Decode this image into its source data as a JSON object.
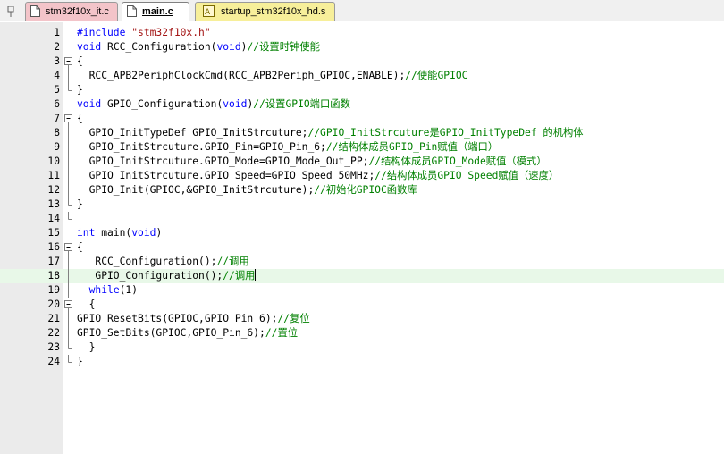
{
  "tabs": [
    {
      "label": "stm32f10x_it.c",
      "color": "#f3c4c9"
    },
    {
      "label": "main.c",
      "color": "#ffffff",
      "active": true
    },
    {
      "label": "startup_stm32f10x_hd.s",
      "color": "#f7ef9a"
    }
  ],
  "editor": {
    "colors": {
      "keyword": "#0000ff",
      "string": "#a31515",
      "comment": "#008000",
      "current_line": "#e8f8e8"
    },
    "current_line": 18,
    "lines": [
      {
        "n": "1",
        "fold": "",
        "segs": [
          {
            "t": "pp",
            "v": "#include "
          },
          {
            "t": "str",
            "v": "\"stm32f10x.h\""
          }
        ]
      },
      {
        "n": "2",
        "fold": "",
        "segs": [
          {
            "t": "kw",
            "v": "void"
          },
          {
            "t": "",
            "v": " RCC_Configuration("
          },
          {
            "t": "kw",
            "v": "void"
          },
          {
            "t": "",
            "v": ")"
          },
          {
            "t": "cm",
            "v": "//设置时钟使能"
          }
        ]
      },
      {
        "n": "3",
        "fold": "start",
        "segs": [
          {
            "t": "",
            "v": "{"
          }
        ]
      },
      {
        "n": "4",
        "fold": "mid",
        "segs": [
          {
            "t": "",
            "v": "  RCC_APB2PeriphClockCmd(RCC_APB2Periph_GPIOC,ENABLE);"
          },
          {
            "t": "cm",
            "v": "//使能GPIOC"
          }
        ]
      },
      {
        "n": "5",
        "fold": "end",
        "segs": [
          {
            "t": "",
            "v": "}"
          }
        ]
      },
      {
        "n": "6",
        "fold": "",
        "segs": [
          {
            "t": "kw",
            "v": "void"
          },
          {
            "t": "",
            "v": " GPIO_Configuration("
          },
          {
            "t": "kw",
            "v": "void"
          },
          {
            "t": "",
            "v": ")"
          },
          {
            "t": "cm",
            "v": "//设置GPIO端口函数"
          }
        ]
      },
      {
        "n": "7",
        "fold": "start",
        "segs": [
          {
            "t": "",
            "v": "{"
          }
        ]
      },
      {
        "n": "8",
        "fold": "mid",
        "segs": [
          {
            "t": "",
            "v": "  GPIO_InitTypeDef GPIO_InitStrcuture;"
          },
          {
            "t": "cm",
            "v": "//GPIO_InitStrcuture是GPIO_InitTypeDef 的机构体"
          }
        ]
      },
      {
        "n": "9",
        "fold": "mid",
        "segs": [
          {
            "t": "",
            "v": "  GPIO_InitStrcuture.GPIO_Pin=GPIO_Pin_6;"
          },
          {
            "t": "cm",
            "v": "//结构体成员GPIO_Pin赋值（端口）"
          }
        ]
      },
      {
        "n": "10",
        "fold": "mid",
        "segs": [
          {
            "t": "",
            "v": "  GPIO_InitStrcuture.GPIO_Mode=GPIO_Mode_Out_PP;"
          },
          {
            "t": "cm",
            "v": "//结构体成员GPIO_Mode赋值（模式）"
          }
        ]
      },
      {
        "n": "11",
        "fold": "mid",
        "segs": [
          {
            "t": "",
            "v": "  GPIO_InitStrcuture.GPIO_Speed=GPIO_Speed_50MHz;"
          },
          {
            "t": "cm",
            "v": "//结构体成员GPIO_Speed赋值（速度）"
          }
        ]
      },
      {
        "n": "12",
        "fold": "mid",
        "segs": [
          {
            "t": "",
            "v": "  GPIO_Init(GPIOC,&GPIO_InitStrcuture);"
          },
          {
            "t": "cm",
            "v": "//初始化GPIOC函数库"
          }
        ]
      },
      {
        "n": "13",
        "fold": "end",
        "segs": [
          {
            "t": "",
            "v": "}"
          }
        ]
      },
      {
        "n": "14",
        "fold": "end",
        "segs": []
      },
      {
        "n": "15",
        "fold": "",
        "segs": [
          {
            "t": "kw",
            "v": "int"
          },
          {
            "t": "",
            "v": " main("
          },
          {
            "t": "kw",
            "v": "void"
          },
          {
            "t": "",
            "v": ")"
          }
        ]
      },
      {
        "n": "16",
        "fold": "start",
        "segs": [
          {
            "t": "",
            "v": "{"
          }
        ]
      },
      {
        "n": "17",
        "fold": "mid",
        "segs": [
          {
            "t": "",
            "v": "   RCC_Configuration();"
          },
          {
            "t": "cm",
            "v": "//调用"
          }
        ]
      },
      {
        "n": "18",
        "fold": "mid",
        "segs": [
          {
            "t": "",
            "v": "   GPIO_Configuration();"
          },
          {
            "t": "cm",
            "v": "//调用"
          }
        ]
      },
      {
        "n": "19",
        "fold": "mid",
        "segs": [
          {
            "t": "",
            "v": "  "
          },
          {
            "t": "kw",
            "v": "while"
          },
          {
            "t": "",
            "v": "(1)"
          }
        ]
      },
      {
        "n": "20",
        "fold": "start",
        "segs": [
          {
            "t": "",
            "v": "  {"
          }
        ]
      },
      {
        "n": "21",
        "fold": "mid",
        "segs": [
          {
            "t": "",
            "v": "GPIO_ResetBits(GPIOC,GPIO_Pin_6);"
          },
          {
            "t": "cm",
            "v": "//复位"
          }
        ]
      },
      {
        "n": "22",
        "fold": "mid",
        "segs": [
          {
            "t": "",
            "v": "GPIO_SetBits(GPIOC,GPIO_Pin_6);"
          },
          {
            "t": "cm",
            "v": "//置位"
          }
        ]
      },
      {
        "n": "23",
        "fold": "end",
        "segs": [
          {
            "t": "",
            "v": "  }"
          }
        ]
      },
      {
        "n": "24",
        "fold": "end",
        "segs": [
          {
            "t": "",
            "v": "}"
          }
        ]
      }
    ]
  }
}
